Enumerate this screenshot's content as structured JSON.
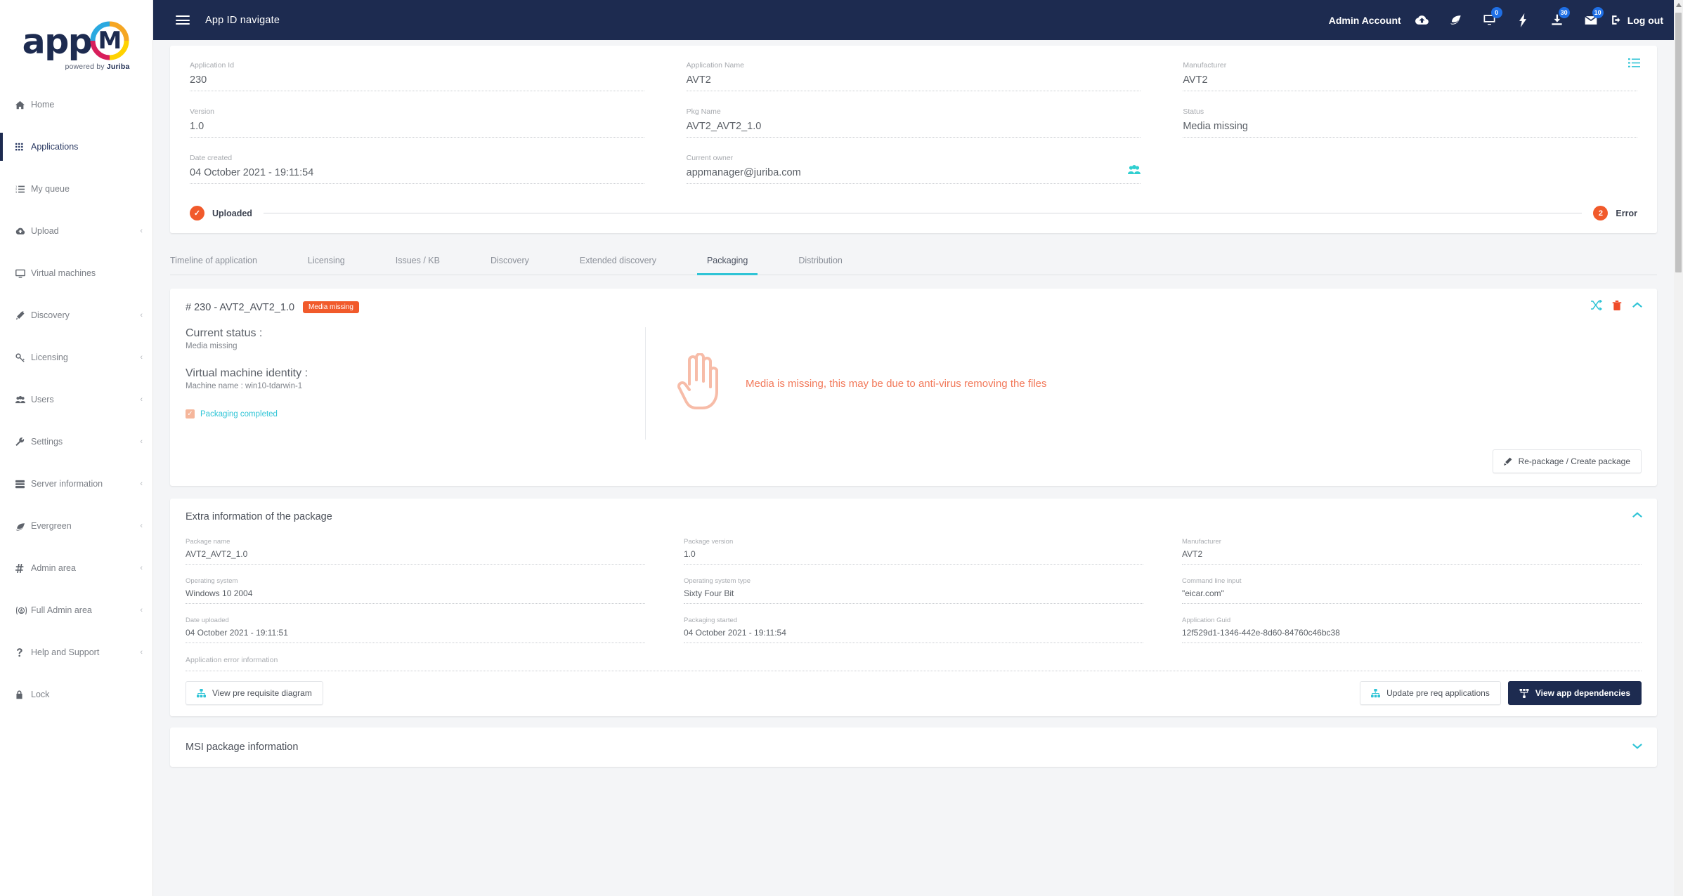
{
  "brand": {
    "logo_text": "app",
    "logo_letter": "M",
    "powered_prefix": "powered by ",
    "powered_name": "Juriba"
  },
  "topbar": {
    "title": "App ID navigate",
    "account": "Admin Account",
    "logout": "Log out",
    "icons": [
      {
        "name": "cloud-upload-icon",
        "badge": ""
      },
      {
        "name": "leaf-icon",
        "badge": ""
      },
      {
        "name": "monitor-icon",
        "badge": "0"
      },
      {
        "name": "bolt-icon",
        "badge": ""
      },
      {
        "name": "download-icon",
        "badge": "30"
      },
      {
        "name": "envelope-icon",
        "badge": "10"
      }
    ]
  },
  "sidebar": {
    "items": [
      {
        "label": "Home",
        "icon": "home-icon",
        "caret": false,
        "active": false
      },
      {
        "label": "Applications",
        "icon": "grid-icon",
        "caret": false,
        "active": true
      },
      {
        "label": "My queue",
        "icon": "list-ol-icon",
        "caret": false,
        "active": false
      },
      {
        "label": "Upload",
        "icon": "cloud-upload-icon",
        "caret": true,
        "active": false
      },
      {
        "label": "Virtual machines",
        "icon": "desktop-icon",
        "caret": false,
        "active": false
      },
      {
        "label": "Discovery",
        "icon": "magic-wand-icon",
        "caret": true,
        "active": false
      },
      {
        "label": "Licensing",
        "icon": "key-icon",
        "caret": true,
        "active": false
      },
      {
        "label": "Users",
        "icon": "users-icon",
        "caret": true,
        "active": false
      },
      {
        "label": "Settings",
        "icon": "wrench-icon",
        "caret": true,
        "active": false
      },
      {
        "label": "Server information",
        "icon": "server-icon",
        "caret": true,
        "active": false
      },
      {
        "label": "Evergreen",
        "icon": "leaf-icon",
        "caret": true,
        "active": false
      },
      {
        "label": "Admin area",
        "icon": "hash-icon",
        "caret": true,
        "active": false
      },
      {
        "label": "Full Admin area",
        "icon": "admin-badge-icon",
        "caret": true,
        "active": false
      },
      {
        "label": "Help and Support",
        "icon": "question-icon",
        "caret": true,
        "active": false
      },
      {
        "label": "Lock",
        "icon": "lock-icon",
        "caret": false,
        "active": false
      }
    ]
  },
  "summary": {
    "fields": [
      {
        "label": "Application Id",
        "value": "230"
      },
      {
        "label": "Application Name",
        "value": "AVT2"
      },
      {
        "label": "Manufacturer",
        "value": "AVT2"
      },
      {
        "label": "Version",
        "value": "1.0"
      },
      {
        "label": "Pkg Name",
        "value": "AVT2_AVT2_1.0"
      },
      {
        "label": "Status",
        "value": "Media missing"
      },
      {
        "label": "Date created",
        "value": "04 October 2021 - 19:11:54"
      },
      {
        "label": "Current owner",
        "value": "appmanager@juriba.com"
      },
      {
        "label": "",
        "value": ""
      }
    ],
    "stepper": {
      "first_label": "Uploaded",
      "first_mark": "✓",
      "last_label": "Error",
      "last_mark": "2"
    }
  },
  "tabs": [
    {
      "label": "Timeline of application",
      "active": false
    },
    {
      "label": "Licensing",
      "active": false
    },
    {
      "label": "Issues / KB",
      "active": false
    },
    {
      "label": "Discovery",
      "active": false
    },
    {
      "label": "Extended discovery",
      "active": false
    },
    {
      "label": "Packaging",
      "active": true
    },
    {
      "label": "Distribution",
      "active": false
    }
  ],
  "packaging": {
    "title": "# 230 - AVT2_AVT2_1.0",
    "badge": "Media missing",
    "current_status_label": "Current status :",
    "current_status_value": "Media missing",
    "vm_identity_label": "Virtual machine identity :",
    "vm_identity_value": "Machine name : win10-tdarwin-1",
    "completed_label": "Packaging completed",
    "completed_mark": "✓",
    "error_message": "Media is missing, this may be due to anti-virus removing the files",
    "repackage_button": "Re-package / Create package"
  },
  "extra": {
    "title": "Extra information of the package",
    "fields": [
      {
        "label": "Package name",
        "value": "AVT2_AVT2_1.0"
      },
      {
        "label": "Package version",
        "value": "1.0"
      },
      {
        "label": "Manufacturer",
        "value": "AVT2"
      },
      {
        "label": "Operating system",
        "value": "Windows 10 2004"
      },
      {
        "label": "Operating system type",
        "value": "Sixty Four Bit"
      },
      {
        "label": "Command line input",
        "value": "\"eicar.com\""
      },
      {
        "label": "Date uploaded",
        "value": "04 October 2021 - 19:11:51"
      },
      {
        "label": "Packaging started",
        "value": "04 October 2021 - 19:11:54"
      },
      {
        "label": "Application Guid",
        "value": "12f529d1-1346-442e-8d60-84760c46bc38"
      }
    ],
    "error_info_label": "Application error information",
    "buttons": {
      "view_prereq": "View pre requisite diagram",
      "update_prereq": "Update pre req applications",
      "view_deps": "View app dependencies"
    }
  },
  "msi": {
    "title": "MSI package information"
  },
  "colors": {
    "navy": "#1d2b50",
    "accent_teal": "#2fc4d6",
    "danger_orange": "#f15a2b",
    "badge_blue": "#1f6fe5"
  }
}
